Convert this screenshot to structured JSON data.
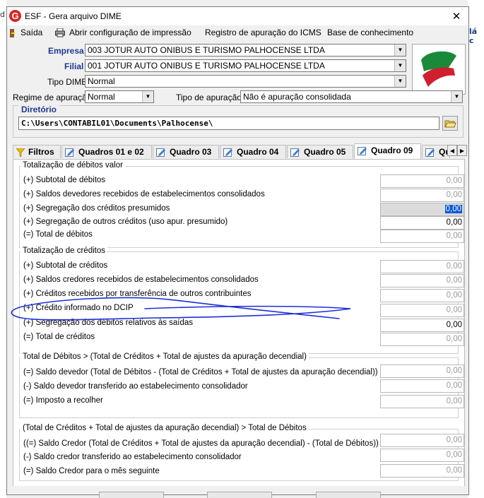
{
  "background": {
    "left_fragment": "d",
    "right_fragment": "lá c"
  },
  "window": {
    "title": "ESF - Gera arquivo DIME",
    "icon": "G",
    "close_glyph": "✕"
  },
  "menu": [
    {
      "label": "Saída",
      "icon": "exit-icon"
    },
    {
      "label": "Abrir configuração de impressão",
      "icon": "printer-icon"
    },
    {
      "label": "Registro de apuração do ICMS"
    },
    {
      "label": "Base de conhecimento"
    }
  ],
  "form": {
    "empresa_label": "Empresa",
    "empresa_value": "003 JOTUR AUTO ONIBUS E TURISMO PALHOCENSE LTDA",
    "filial_label": "Filial",
    "filial_value": "001 JOTUR AUTO ONIBUS E TURISMO PALHOCENSE LTDA",
    "tipo_dime_label": "Tipo DIME",
    "tipo_dime_value": "Normal",
    "regime_label": "Regime de apuração",
    "regime_value": "Normal",
    "tipo_apuracao_label": "Tipo de apuração",
    "tipo_apuracao_value": "Não é apuração consolidada",
    "diretorio_label": "Diretório",
    "diretorio_value": "C:\\Users\\CONTABIL01\\Documents\\Palhocense\\"
  },
  "tabs": [
    {
      "label": "Filtros",
      "icon": "filter-icon"
    },
    {
      "label": "Quadros 01 e 02",
      "icon": "edit-icon"
    },
    {
      "label": "Quadro 03",
      "icon": "edit-icon"
    },
    {
      "label": "Quadro 04",
      "icon": "edit-icon"
    },
    {
      "label": "Quadro 05",
      "icon": "edit-icon"
    },
    {
      "label": "Quadro 09",
      "icon": "edit-icon",
      "active": true
    },
    {
      "label": "Qu",
      "icon": "edit-icon"
    }
  ],
  "groups": [
    {
      "title": "Totalização de débitos valor",
      "rows": [
        {
          "label": "(+) Subtotal de débitos",
          "value": "0,00"
        },
        {
          "label": "(+) Saldos devedores recebidos de estabelecimentos consolidados",
          "value": "0,00"
        },
        {
          "label": "(+) Segregação dos créditos presumidos",
          "value": "0,00",
          "state": "selected"
        },
        {
          "label": "(+) Segregação de outros créditos (uso apur. presumido)",
          "value": "0,00",
          "state": "editable"
        },
        {
          "label": "(=) Total de débitos",
          "value": "0,00"
        }
      ]
    },
    {
      "title": "Totalização de créditos",
      "rows": [
        {
          "label": "(+) Subtotal de créditos",
          "value": "0,00"
        },
        {
          "label": "(+) Saldos credores recebidos de estabelecimentos consolidados",
          "value": "0,00"
        },
        {
          "label": "(+) Créditos recebidos por transferência de outros contribuintes",
          "value": "0,00"
        },
        {
          "label": "(+) Crédito informado no DCIP",
          "value": "0,00"
        },
        {
          "label": "(+) Segregação dos débitos relativos às saídas",
          "value": "0,00",
          "state": "editable"
        },
        {
          "label": "(=) Total de créditos",
          "value": "0,00"
        }
      ]
    },
    {
      "title": "Total de Débitos > (Total de Créditos + Total de ajustes da apuração decendial)",
      "rows": [
        {
          "label": "(=) Saldo devedor (Total de Débitos - (Total de Créditos + Total de ajustes da apuração decendial))",
          "value": "0,00"
        },
        {
          "label": "(-) Saldo devedor transferido ao estabelecimento consolidador",
          "value": "0,00"
        },
        {
          "label": "(=) Imposto a recolher",
          "value": "0,00"
        }
      ]
    },
    {
      "title": "(Total de Créditos + Total de ajustes da apuração decendial) > Total de Débitos",
      "rows": [
        {
          "label": "((=) Saldo Credor (Total de Créditos + Total de ajustes da apuração decendial) - (Total de Débitos))",
          "value": "0,00"
        },
        {
          "label": "(-) Saldo credor transferido ao estabelecimento consolidador",
          "value": "0,00"
        },
        {
          "label": "(=) Saldo Credor para o mês seguinte",
          "value": "0,00"
        }
      ]
    }
  ],
  "colors": {
    "label_blue": "#1f3a8f",
    "annotation": "#1d2fd6",
    "selection": "#0a58d6"
  }
}
